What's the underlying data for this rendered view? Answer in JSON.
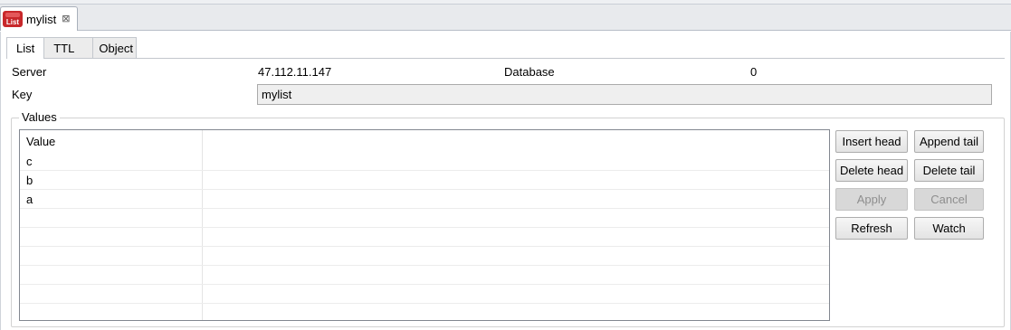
{
  "editor": {
    "tab_title": "mylist",
    "tab_badge": "List",
    "close_glyph": "⊠"
  },
  "subtabs": [
    "List",
    "TTL",
    "Object"
  ],
  "info": {
    "server_label": "Server",
    "server_value": "47.112.11.147",
    "database_label": "Database",
    "database_value": "0",
    "key_label": "Key",
    "key_value": "mylist"
  },
  "values": {
    "group_label": "Values",
    "column_header": "Value",
    "rows": [
      "c",
      "b",
      "a",
      "",
      "",
      "",
      "",
      "",
      ""
    ]
  },
  "buttons": {
    "insert_head": "Insert head",
    "append_tail": "Append tail",
    "delete_head": "Delete head",
    "delete_tail": "Delete tail",
    "apply": "Apply",
    "cancel": "Cancel",
    "refresh": "Refresh",
    "watch": "Watch"
  }
}
